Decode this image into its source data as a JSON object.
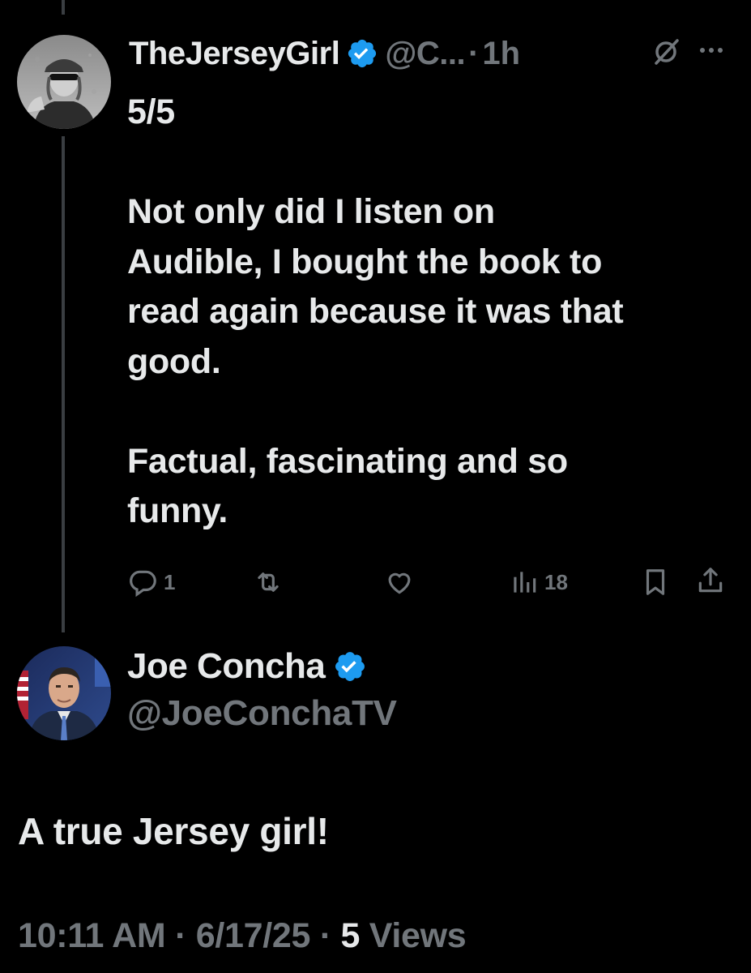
{
  "thread_tweet": {
    "display_name": "TheJerseyGirl",
    "handle": "@C...",
    "separator": "·",
    "time": "1h",
    "text": "5/5\n\nNot only did I listen on\nAudible, I bought the book to\nread again because it was that\ngood.\n\nFactual, fascinating and so\nfunny.",
    "reply_count": "1",
    "view_count": "18"
  },
  "main_tweet": {
    "display_name": "Joe Concha",
    "handle": "@JoeConchaTV",
    "text": "A true Jersey girl!",
    "timestamp": "10:11 AM",
    "date": "6/17/25",
    "separator": "·",
    "views_count": "5",
    "views_label": "Views"
  },
  "icons": {
    "verified": "verified-badge-icon",
    "grok": "grok-icon",
    "more": "more-icon",
    "reply": "reply-icon",
    "retweet": "retweet-icon",
    "like": "like-icon",
    "views": "views-icon",
    "bookmark": "bookmark-icon",
    "share": "share-icon"
  },
  "colors": {
    "background": "#000000",
    "text": "#e7e9ea",
    "secondary": "#71767b",
    "verified": "#1d9bf0",
    "thread_line": "#3a3e42"
  }
}
